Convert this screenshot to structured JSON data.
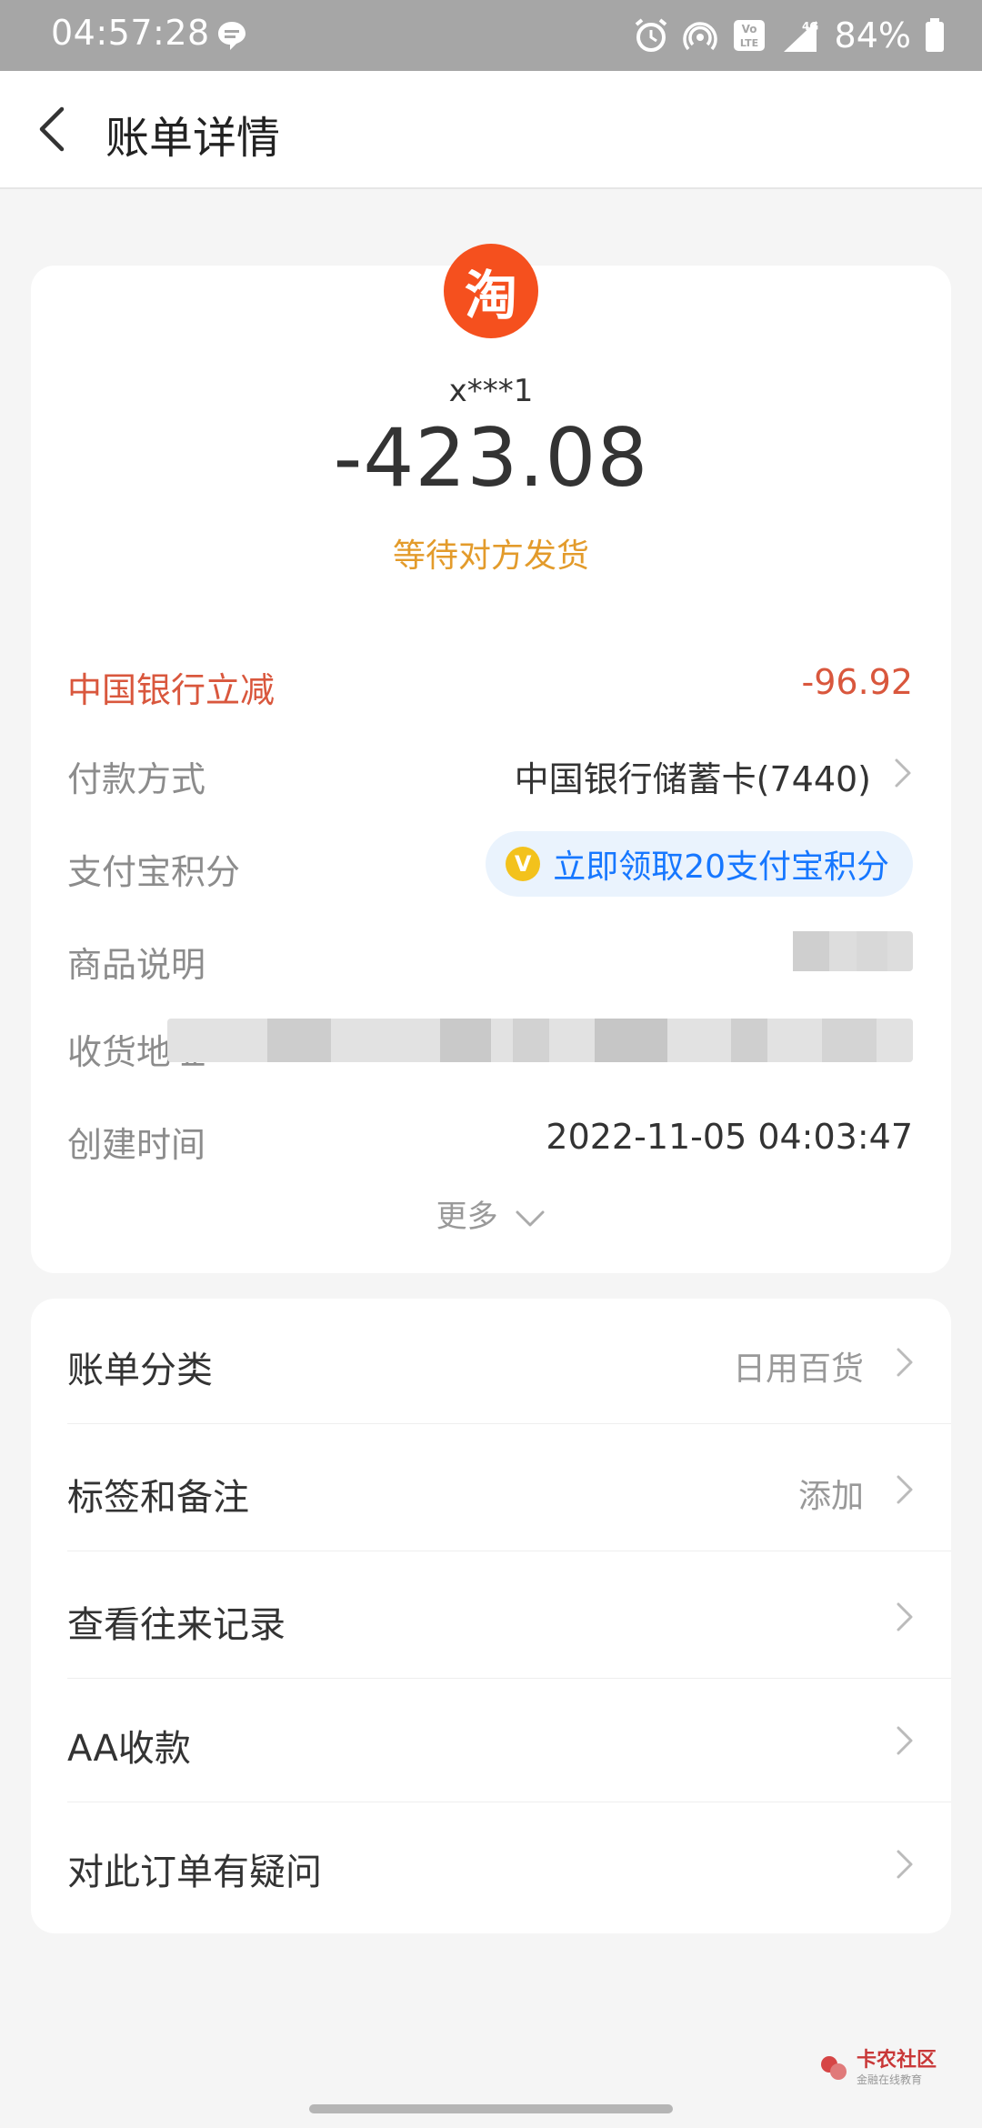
{
  "status_bar": {
    "time": "04:57:28",
    "battery": "84%",
    "network": "4G",
    "volte": "Vo LTE"
  },
  "header": {
    "title": "账单详情"
  },
  "merchant": {
    "logo_char": "淘",
    "name": "x***1"
  },
  "amount": "-423.08",
  "status": "等待对方发货",
  "details": {
    "discount": {
      "label": "中国银行立减",
      "value": "-96.92"
    },
    "payment": {
      "label": "付款方式",
      "value": "中国银行储蓄卡(7440)"
    },
    "points": {
      "label": "支付宝积分",
      "value": "立即领取20支付宝积分"
    },
    "product": {
      "label": "商品说明"
    },
    "address": {
      "label": "收货地址"
    },
    "created": {
      "label": "创建时间",
      "value": "2022-11-05 04:03:47"
    }
  },
  "more": "更多",
  "actions": [
    {
      "label": "账单分类",
      "value": "日用百货"
    },
    {
      "label": "标签和备注",
      "value": "添加"
    },
    {
      "label": "查看往来记录",
      "value": ""
    },
    {
      "label": "AA收款",
      "value": ""
    },
    {
      "label": "对此订单有疑问",
      "value": ""
    }
  ],
  "watermark": {
    "text": "卡农社区",
    "sub": "金融在线教育"
  },
  "colors": {
    "accent_orange": "#e39b2b",
    "discount_red": "#d9573d",
    "link_blue": "#1677ff",
    "taobao_orange": "#f5501e"
  }
}
